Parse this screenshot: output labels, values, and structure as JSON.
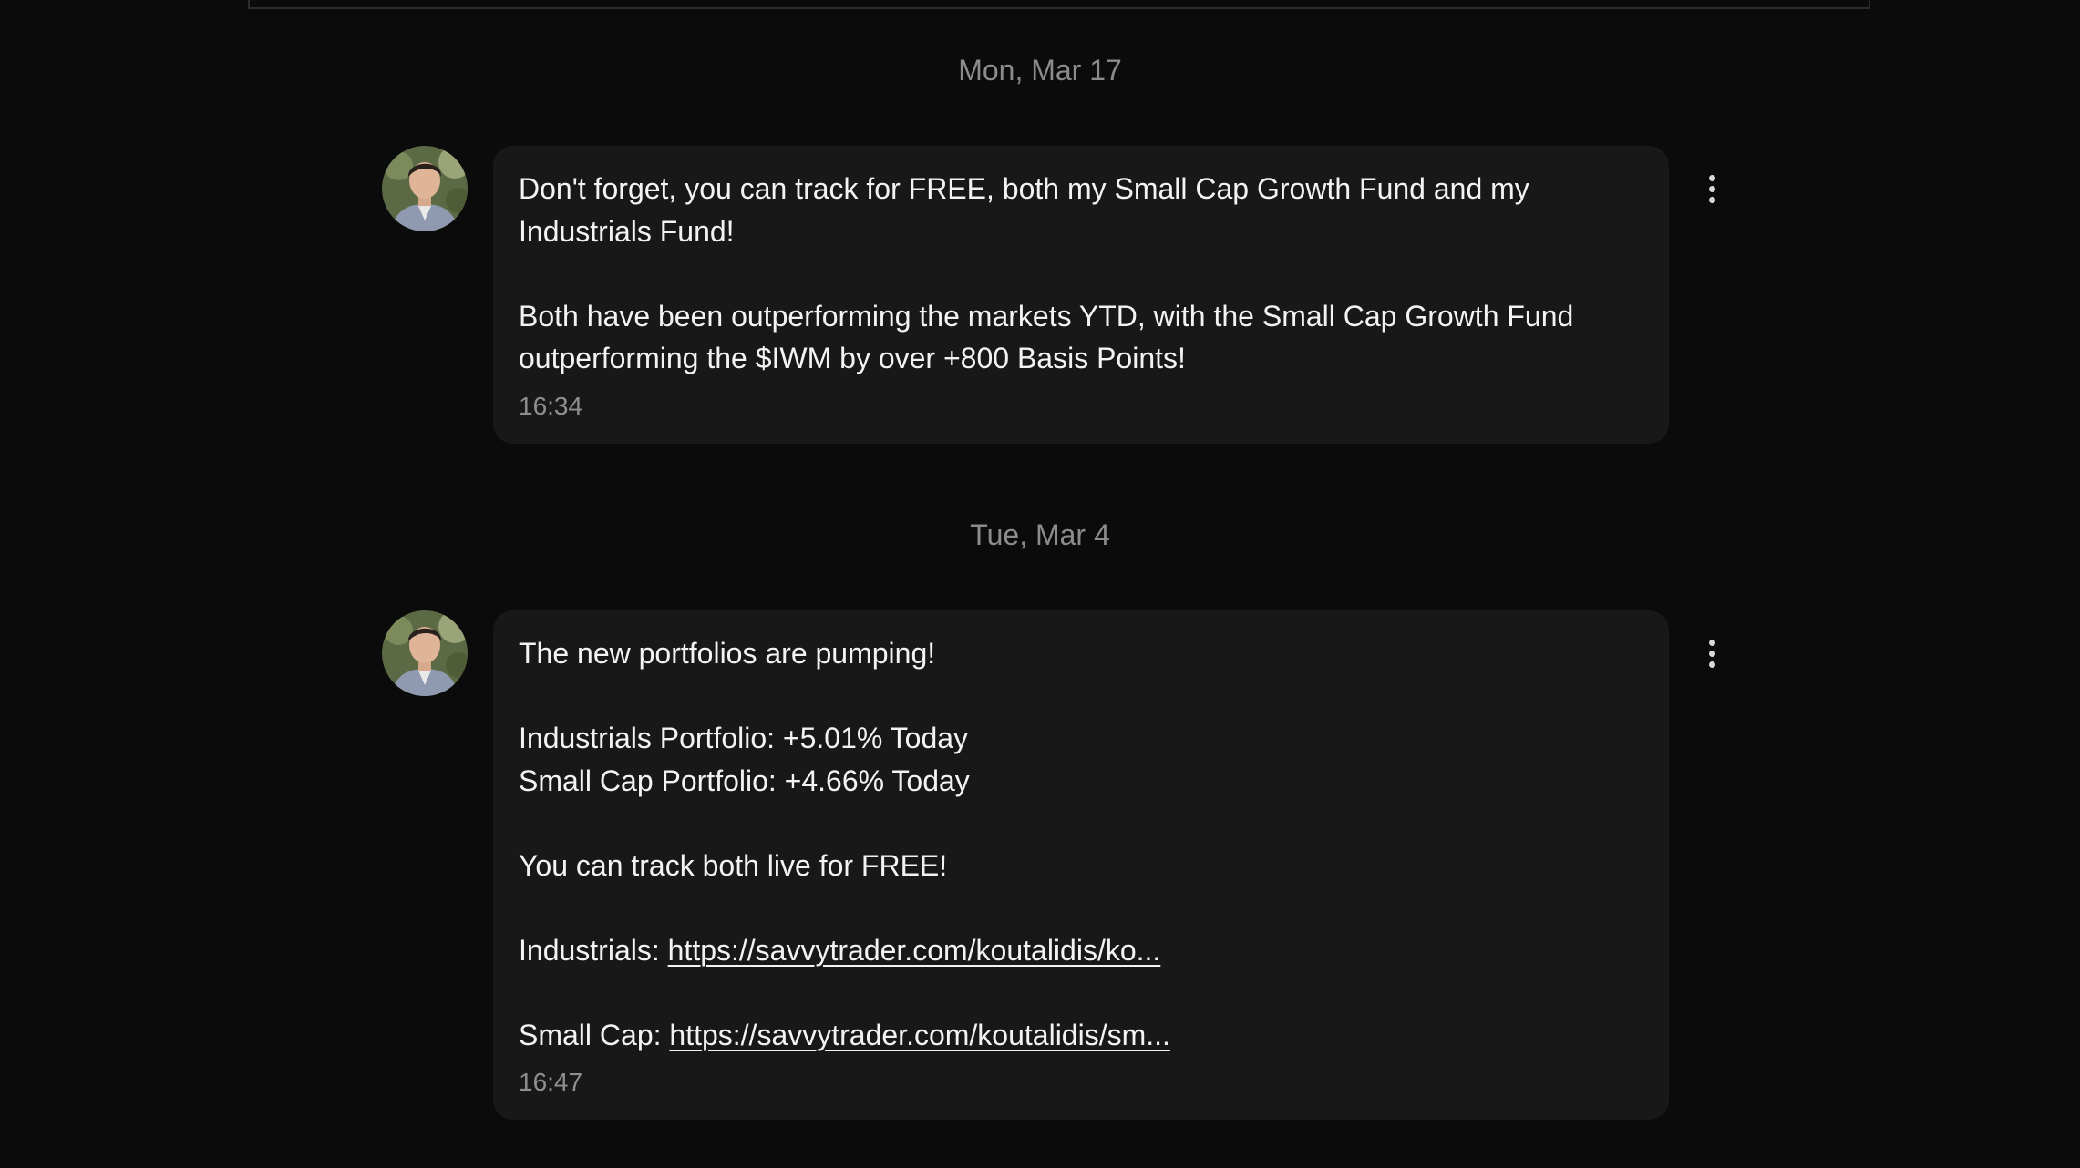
{
  "messages": [
    {
      "date": "Mon, Mar 17",
      "lines": [
        "Don't forget, you can track for FREE, both my Small Cap Growth Fund and my",
        "Industrials Fund!",
        "",
        "Both have been outperforming the markets YTD, with the Small Cap Growth Fund",
        "outperforming the $IWM by over +800 Basis Points!"
      ],
      "time": "16:34"
    },
    {
      "date": "Tue, Mar 4",
      "lines": [
        "The new portfolios are pumping!",
        "",
        "Industrials Portfolio: +5.01% Today",
        "Small Cap Portfolio: +4.66% Today",
        "",
        "You can track both live for FREE!",
        ""
      ],
      "links": [
        {
          "prefix": "Industrials: ",
          "url": "https://savvytrader.com/koutalidis/ko..."
        },
        {
          "prefix": "Small Cap: ",
          "url": "https://savvytrader.com/koutalidis/sm..."
        }
      ],
      "time": "16:47"
    }
  ],
  "icons": {
    "avatar": "avatar-photo",
    "menu": "kebab-menu-icon"
  },
  "colors": {
    "background": "#0b0b0b",
    "bubble": "#181818",
    "date_text": "#8c8c8c",
    "time_text": "#8f8f8f"
  }
}
